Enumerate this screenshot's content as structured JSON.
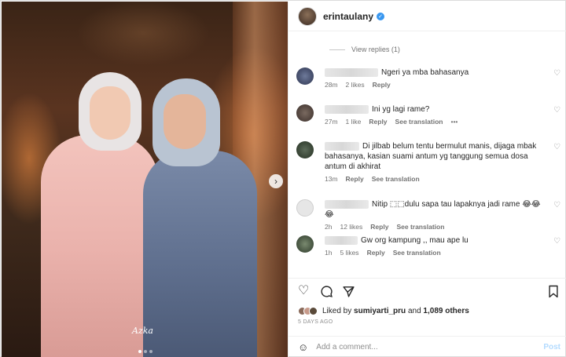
{
  "post": {
    "username": "erintaulany",
    "photo_watermark": "Azka"
  },
  "view_replies": "View replies (1)",
  "comments": [
    {
      "text": "Ngeri ya mba bahasanya",
      "time": "28m",
      "likes": "2 likes",
      "reply": "Reply",
      "see_translation": ""
    },
    {
      "text": "Ini yg lagi rame?",
      "time": "27m",
      "likes": "1 like",
      "reply": "Reply",
      "see_translation": "See translation",
      "more": "•••"
    },
    {
      "text": "Di jilbab belum tentu bermulut manis, dijaga mbak bahasanya, kasian suami antum yg tanggung semua dosa antum di akhirat",
      "time": "13m",
      "likes": "",
      "reply": "Reply",
      "see_translation": "See translation"
    },
    {
      "text": "Nitip ⬚⬚dulu sapa tau lapaknya jadi rame 😂😂😂",
      "time": "2h",
      "likes": "12 likes",
      "reply": "Reply",
      "see_translation": "See translation"
    },
    {
      "text": "Gw org kampung ,, mau ape lu",
      "time": "1h",
      "likes": "5 likes",
      "reply": "Reply",
      "see_translation": "See translation"
    }
  ],
  "likes": {
    "prefix": "Liked by",
    "user": "sumiyarti_pru",
    "and": "and",
    "others": "1,089 others"
  },
  "date": "5 DAYS AGO",
  "comment_input": {
    "placeholder": "Add a comment...",
    "post_label": "Post"
  },
  "icons": {
    "like": "heart-outline",
    "comment": "speech-bubble",
    "share": "paper-plane",
    "save": "bookmark",
    "emoji": "smiley",
    "next": "chevron-right"
  },
  "colors": {
    "verified": "#3897f0",
    "post_button": "#b3dbff",
    "meta_text": "#737373"
  }
}
